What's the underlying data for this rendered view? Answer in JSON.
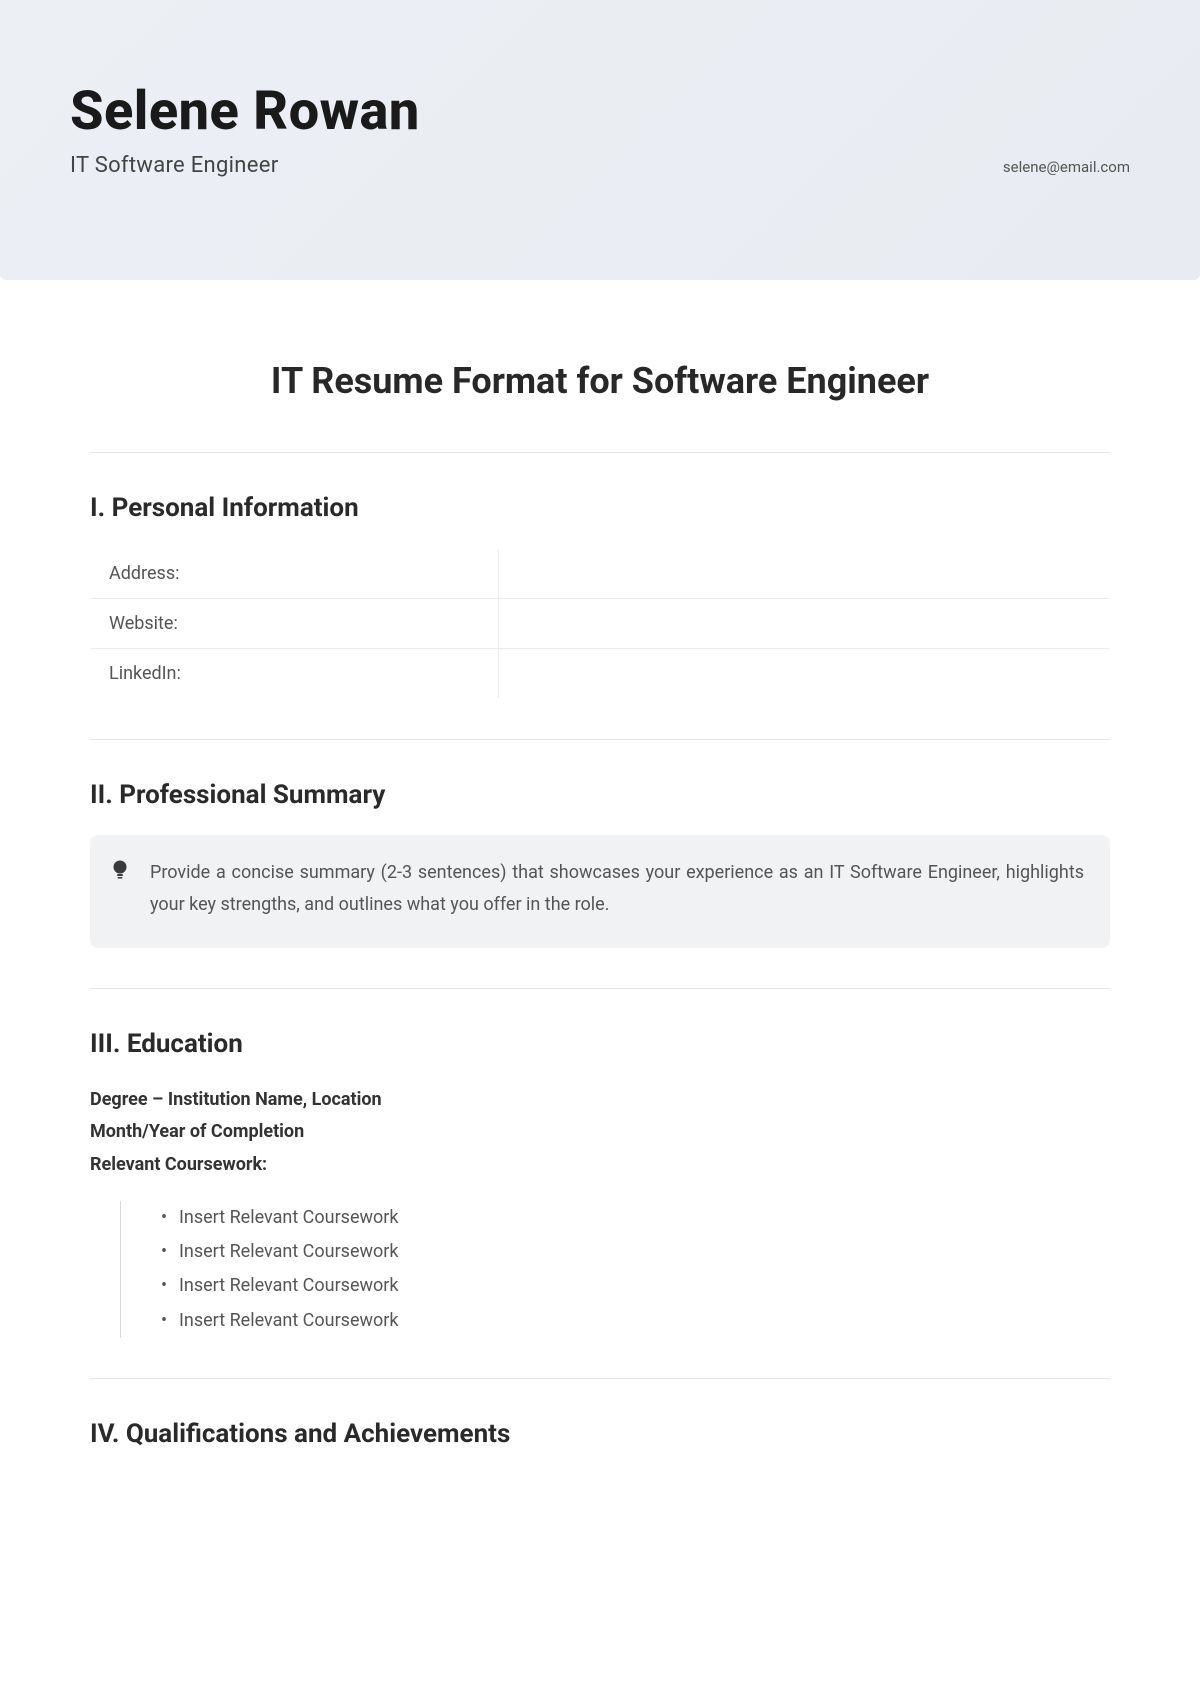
{
  "header": {
    "name": "Selene Rowan",
    "subtitle": "IT Software Engineer",
    "email": "selene@email.com"
  },
  "page_title": "IT Resume Format for Software Engineer",
  "sections": {
    "personal": {
      "title": "I. Personal Information",
      "rows": [
        {
          "label": "Address:",
          "value": ""
        },
        {
          "label": "Website:",
          "value": ""
        },
        {
          "label": "LinkedIn:",
          "value": ""
        }
      ]
    },
    "summary": {
      "title": "II. Professional Summary",
      "callout": "Provide a concise summary (2-3 sentences) that showcases your experience as an IT Software Engineer, highlights your key strengths, and outlines what you offer in the role."
    },
    "education": {
      "title": "III. Education",
      "line1": "Degree – Institution Name, Location",
      "line2": "Month/Year of Completion",
      "line3": "Relevant Coursework:",
      "courses": [
        "Insert Relevant Coursework",
        "Insert Relevant Coursework",
        "Insert Relevant Coursework",
        "Insert Relevant Coursework"
      ]
    },
    "qualifications": {
      "title": "IV. Qualifications and Achievements"
    }
  }
}
